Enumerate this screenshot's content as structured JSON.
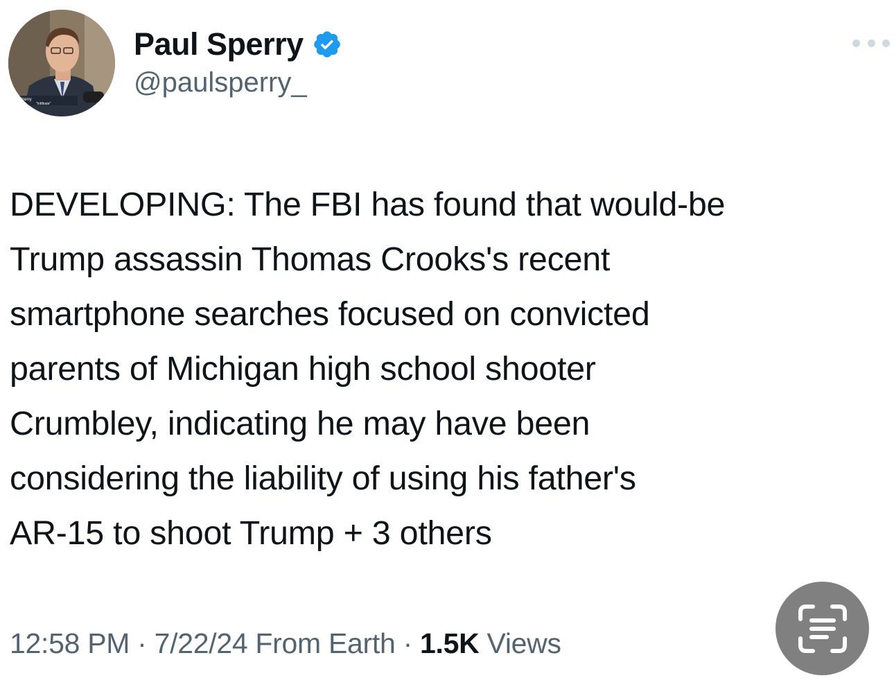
{
  "author": {
    "display_name": "Paul Sperry",
    "handle": "@paulsperry_",
    "verified": true,
    "badge_color": "#1d9bf0"
  },
  "avatar": {
    "caption_top": "Sperry",
    "caption_bottom": "\"Infiltrate\""
  },
  "tweet": {
    "lines": [
      "DEVELOPING: The FBI has found that would-be",
      "Trump assassin Thomas Crooks's recent",
      "smartphone searches focused on convicted",
      "parents of Michigan high school shooter",
      "Crumbley, indicating he may have been",
      "considering the liability of using his father's",
      "AR-15 to shoot Trump + 3 others"
    ]
  },
  "meta": {
    "time": "12:58 PM",
    "separator": " · ",
    "date": "7/22/24",
    "source": " From Earth",
    "views_count": "1.5K",
    "views_label": " Views"
  },
  "icons": {
    "more": "more-dots-icon",
    "live_text": "live-text-scan-icon",
    "verified": "verified-badge-icon"
  },
  "colors": {
    "text_primary": "#0f1419",
    "text_secondary": "#536471",
    "live_text_bg": "#808080"
  }
}
